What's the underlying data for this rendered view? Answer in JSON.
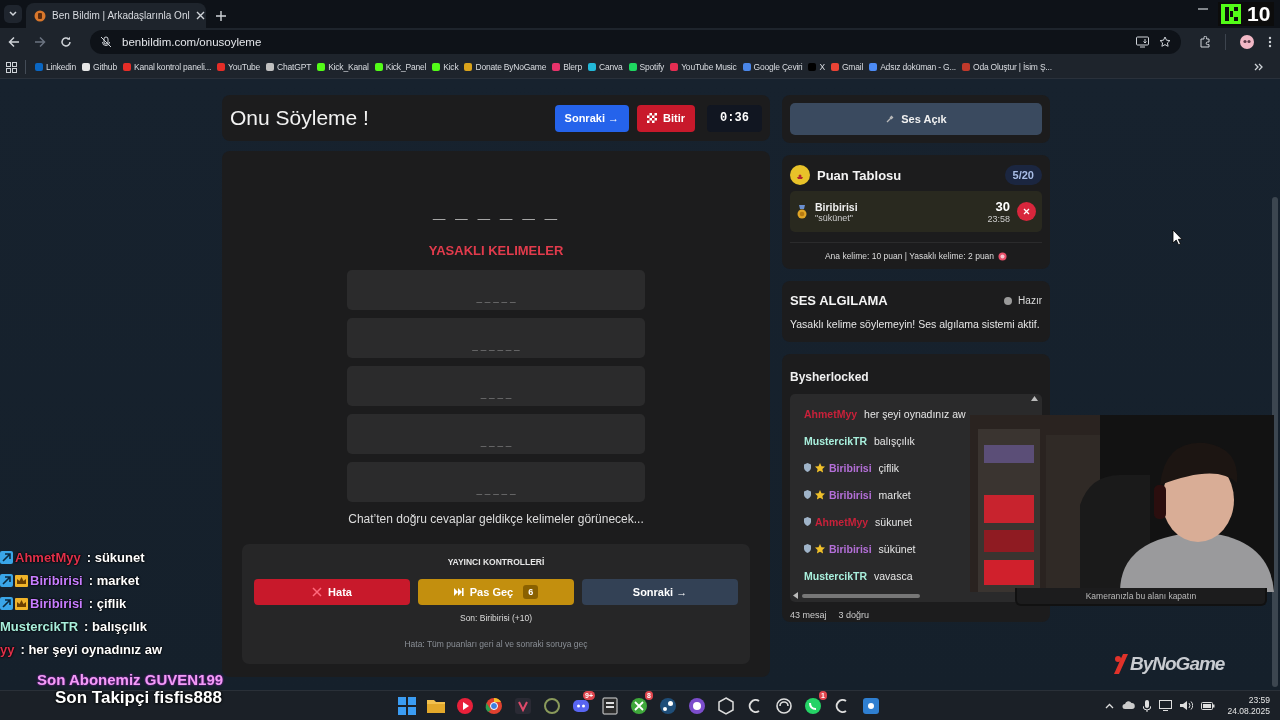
{
  "browser": {
    "tab_title": "Ben Bildim | Arkadaşlarınla Onl",
    "url": "benbildim.com/onusoyleme",
    "bookmarks": [
      {
        "label": "Linkedin",
        "color": "#0a66c2"
      },
      {
        "label": "Github",
        "color": "#e6e6e6"
      },
      {
        "label": "Kanal kontrol paneli...",
        "color": "#e52d27"
      },
      {
        "label": "YouTube",
        "color": "#e52d27"
      },
      {
        "label": "ChatGPT",
        "color": "#bfbfbf"
      },
      {
        "label": "Kick_Kanal",
        "color": "#53fc18"
      },
      {
        "label": "Kick_Panel",
        "color": "#53fc18"
      },
      {
        "label": "Kick",
        "color": "#53fc18"
      },
      {
        "label": "Donate ByNoGame",
        "color": "#d9a21b"
      },
      {
        "label": "Blerp",
        "color": "#e8336b"
      },
      {
        "label": "Canva",
        "color": "#22b8d8"
      },
      {
        "label": "Spotify",
        "color": "#1ed760"
      },
      {
        "label": "YouTube Music",
        "color": "#e52d52"
      },
      {
        "label": "Google Çeviri",
        "color": "#4a86e8"
      },
      {
        "label": "X",
        "color": "#000000"
      },
      {
        "label": "Gmail",
        "color": "#ea4335"
      },
      {
        "label": "Adsız doküman - G...",
        "color": "#4c8bf5"
      },
      {
        "label": "Oda Oluştur | İsim Ş...",
        "color": "#c0392b"
      }
    ]
  },
  "game": {
    "title": "Onu Söyleme !",
    "next_button": "Sonraki →",
    "finish_button": "Bitir",
    "timer": "0:36",
    "hidden_word": "_ _ _ _ _ _",
    "forbidden_title": "YASAKLI KELIMELER",
    "forbidden_words": [
      "_ _ _ _ _",
      "_ _ _ _ _ _",
      "_ _ _ _",
      "_ _ _ _",
      "_ _ _ _ _"
    ],
    "hint": "Chat’ten doğru cevaplar geldikçe kelimeler görünecek...",
    "controls": {
      "title": "YAYINCI KONTROLLERİ",
      "buttons": [
        {
          "kind": "error",
          "label": "Hata"
        },
        {
          "kind": "pass",
          "label": "Pas Geç",
          "badge": "6"
        },
        {
          "kind": "next",
          "label": "Sonraki →"
        }
      ],
      "last": "Son: Biribirisi (+10)",
      "note": "Hata: Tüm puanları geri al ve sonraki soruya geç"
    }
  },
  "side": {
    "sound_button": "Ses Açık",
    "scoreboard": {
      "title": "Puan Tablosu",
      "count": "5/20",
      "entries": [
        {
          "name": "Biribirisi",
          "word": "\"sükünet\"",
          "score": "30",
          "time": "23:58"
        }
      ],
      "rule": "Ana kelime: 10 puan | Yasaklı kelime: 2 puan"
    },
    "detection": {
      "title": "SES ALGILAMA",
      "status": "Hazır",
      "text": "Yasaklı kelime söylemeyin! Ses algılama sistemi aktif."
    },
    "chat": {
      "channel": "Bysherlocked",
      "messages": [
        {
          "user": "AhmetMyy",
          "color": "#c8213a",
          "text": "her şeyi oynadınız aw",
          "moderator": false,
          "star": false
        },
        {
          "user": "MustercikTR",
          "color": "#a8efdc",
          "text": "balışçılık",
          "moderator": false,
          "star": false
        },
        {
          "user": "Biribirisi",
          "color": "#b46fd8",
          "text": "çiflik",
          "moderator": true,
          "star": true
        },
        {
          "user": "Biribirisi",
          "color": "#b46fd8",
          "text": "market",
          "moderator": true,
          "star": true
        },
        {
          "user": "AhmetMyy",
          "color": "#c8213a",
          "text": "sükunet",
          "moderator": true,
          "star": false
        },
        {
          "user": "Biribirisi",
          "color": "#b46fd8",
          "text": "sükünet",
          "moderator": true,
          "star": true
        },
        {
          "user": "MustercikTR",
          "color": "#a8efdc",
          "text": "vavasca",
          "moderator": false,
          "star": false
        }
      ],
      "message_count": "43 mesaj",
      "correct_count": "3 doğru"
    }
  },
  "overlay": {
    "viewer_count": "10",
    "camera_note": "Kameranızla bu alanı kapatın",
    "brand": "ByNoGame",
    "stream_chat": [
      {
        "user": "AhmetMyy",
        "color": "#e0304a",
        "text": ": sükunet",
        "verified": true,
        "crown": false
      },
      {
        "user": "Biribirisi",
        "color": "#c77dff",
        "text": ": market",
        "verified": true,
        "crown": true
      },
      {
        "user": "Biribirisi",
        "color": "#c77dff",
        "text": ": çiflik",
        "verified": true,
        "crown": true
      },
      {
        "user": "MustercikTR",
        "color": "#a8efdc",
        "text": ": balışçılık",
        "verified": false,
        "crown": false
      },
      {
        "user": "yy",
        "color": "#e0304a",
        "text": ": her şeyi oynadınız aw",
        "verified": false,
        "crown": false
      }
    ],
    "last_subscriber": "Son Abonemiz GUVEN199",
    "last_follower": "Son Takipçi fisfis888"
  },
  "taskbar": {
    "notification_badges": [
      "9+",
      "8",
      "1"
    ],
    "time": "23:59",
    "date": "24.08.2025"
  }
}
